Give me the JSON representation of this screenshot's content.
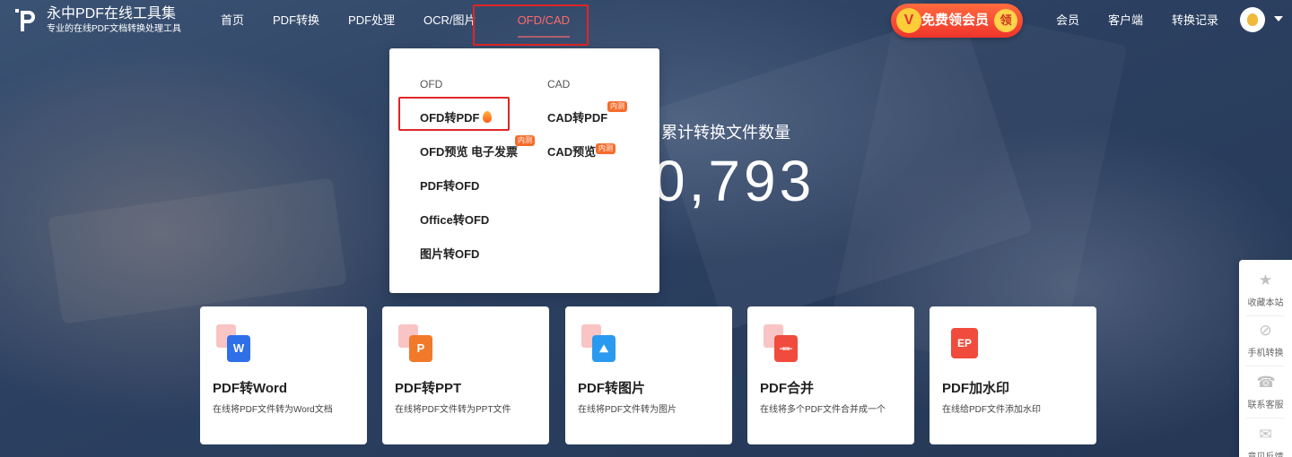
{
  "header": {
    "brand_name": "永中PDF在线工具集",
    "tagline": "专业的在线PDF文档转换处理工具",
    "nav": [
      "首页",
      "PDF转换",
      "PDF处理",
      "OCR/图片",
      "OFD/CAD"
    ],
    "active_nav": "OFD/CAD",
    "vip_button": {
      "v": "V",
      "label": "免费领会员",
      "badge": "领"
    },
    "right_nav": [
      "会员",
      "客户端",
      "转换记录"
    ]
  },
  "hero": {
    "label": "累计转换文件数量",
    "number": "0,793"
  },
  "dropdown": {
    "ofd": {
      "heading": "OFD",
      "items": [
        {
          "label": "OFD转PDF"
        },
        {
          "label": "OFD预览 电子发票",
          "badge": "内测"
        },
        {
          "label": "PDF转OFD"
        },
        {
          "label": "Office转OFD"
        },
        {
          "label": "图片转OFD"
        }
      ]
    },
    "cad": {
      "heading": "CAD",
      "items": [
        {
          "label": "CAD转PDF",
          "badge": "内测"
        },
        {
          "label": "CAD预览",
          "badge": "内测"
        }
      ]
    }
  },
  "cards": [
    {
      "title": "PDF转Word",
      "desc": "在线将PDF文件转为Word文档",
      "glyph": "W",
      "color": "#2f6fe8"
    },
    {
      "title": "PDF转PPT",
      "desc": "在线将PDF文件转为PPT文件",
      "glyph": "P",
      "color": "#f07a2a"
    },
    {
      "title": "PDF转图片",
      "desc": "在线将PDF文件转为图片",
      "glyph": "⛰",
      "color": "#2a9af0"
    },
    {
      "title": "PDF合并",
      "desc": "在线将多个PDF文件合并成一个",
      "glyph": "⇥⇤",
      "color": "#f04b3c"
    },
    {
      "title": "PDF加水印",
      "desc": "在线给PDF文件添加水印",
      "glyph": "EP",
      "color": "#f04b3c"
    }
  ],
  "side": [
    {
      "icon": "★",
      "label": "收藏本站"
    },
    {
      "icon": "⊘",
      "label": "手机转换"
    },
    {
      "icon": "☎",
      "label": "联系客服"
    },
    {
      "icon": "✉",
      "label": "意见反馈"
    }
  ]
}
